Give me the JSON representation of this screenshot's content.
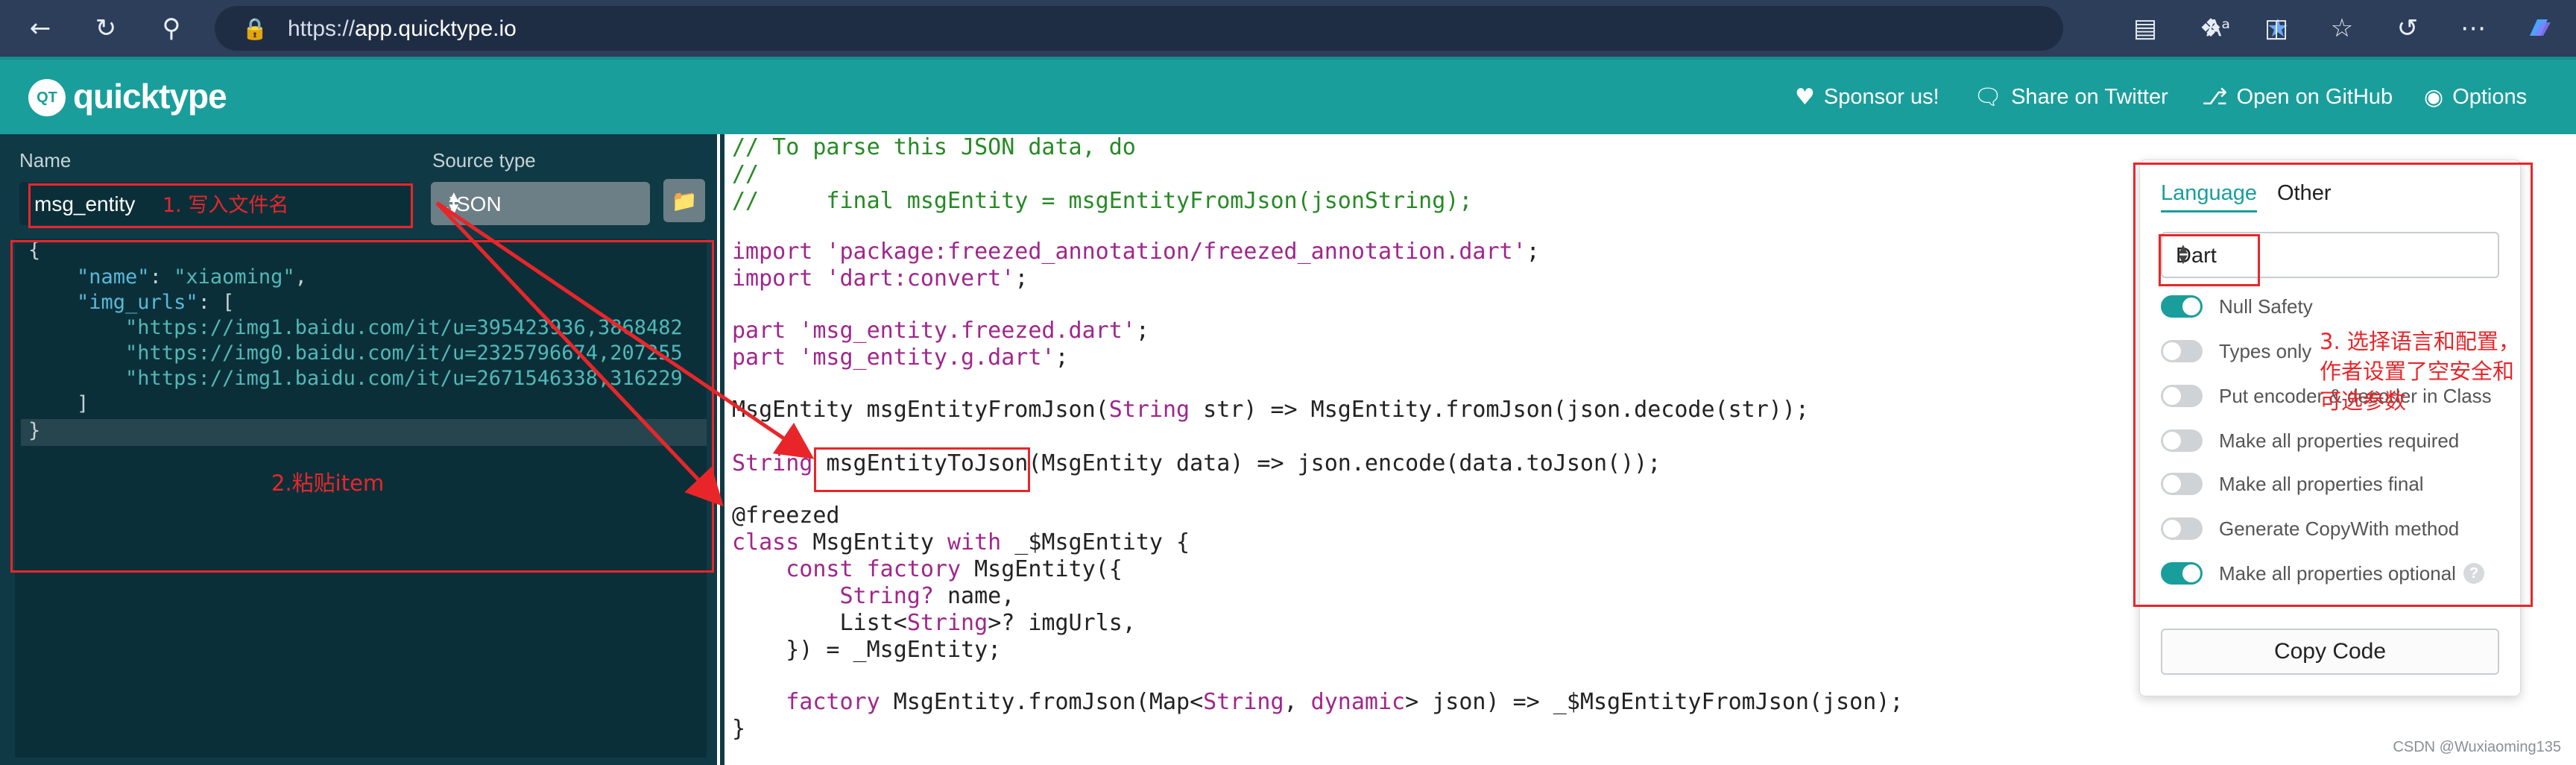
{
  "browser": {
    "url_scheme": "https://",
    "url_host": "app.quicktype.io",
    "icons": [
      "back-arrow-icon",
      "refresh-icon",
      "search-icon",
      "lock-icon",
      "read-aloud-icon",
      "favorite-star-icon",
      "reading-view-icon",
      "extensions-icon",
      "split-screen-icon",
      "favorites-icon",
      "history-icon",
      "more-icon",
      "copilot-icon"
    ]
  },
  "header": {
    "logo_badge": "QT",
    "brand": "quicktype",
    "links": {
      "sponsor": "Sponsor us!",
      "twitter": "Share on Twitter",
      "github": "Open on GitHub",
      "options": "Options"
    }
  },
  "left": {
    "name_label": "Name",
    "name_value": "msg_entity",
    "source_label": "Source type",
    "source_value": "JSON",
    "json_lines": {
      "l1": "{",
      "l2_key": "\"name\"",
      "l2_sep": ": ",
      "l2_val": "\"xiaoming\"",
      "l2_end": ",",
      "l3_key": "\"img_urls\"",
      "l3_rest": ": [",
      "l4": "\"https://img1.baidu.com/it/u=395423936,3868482",
      "l5": "\"https://img0.baidu.com/it/u=2325796674,207255",
      "l6": "\"https://img1.baidu.com/it/u=2671546338,316229",
      "l7": "]",
      "l8": "}"
    }
  },
  "annotations": {
    "a1": "1. 写入文件名",
    "a2": "2.粘贴item",
    "a3": "3. 选择语言和配置，\n作者设置了空安全和\n可选参数"
  },
  "code": {
    "c1": "// To parse this JSON data, do",
    "c2": "//",
    "c3": "//     final msgEntity = msgEntityFromJson(jsonString);",
    "c4_kw": "import",
    "c4_str": " 'package:freezed_annotation/freezed_annotation.dart'",
    "c4_end": ";",
    "c5_kw": "import",
    "c5_str": " 'dart:convert'",
    "c5_end": ";",
    "c6_kw": "part",
    "c6_str": " 'msg_entity.freezed.dart'",
    "c6_end": ";",
    "c7_kw": "part",
    "c7_str": " 'msg_entity.g.dart'",
    "c7_end": ";",
    "c8_a": "MsgEntity msgEntityFromJson(",
    "c8_ty": "String",
    "c8_b": " str) => MsgEntity.fromJson(json.decode(str));",
    "c9_ty": "String",
    "c9_fn": "msgEntityToJson",
    "c9_b": "(MsgEntity data) => json.encode(data.toJson());",
    "c10": "@freezed",
    "c11_kw": "class",
    "c11_b": " MsgEntity ",
    "c11_kw2": "with",
    "c11_c": " _$MsgEntity {",
    "c12_kw": "const factory",
    "c12_b": " MsgEntity({",
    "c13_ty": "String?",
    "c13_b": " name,",
    "c14_a": "List<",
    "c14_ty": "String",
    "c14_b": ">? imgUrls,",
    "c15": "}) = _MsgEntity;",
    "c16_kw": "factory",
    "c16_a": " MsgEntity.fromJson(Map<",
    "c16_ty": "String",
    "c16_b": ", ",
    "c16_ty2": "dynamic",
    "c16_c": "> json) => _$MsgEntityFromJson(json);",
    "c17": "}"
  },
  "options": {
    "tab_language": "Language",
    "tab_other": "Other",
    "language_value": "Dart",
    "items": [
      {
        "label": "Null Safety",
        "on": true
      },
      {
        "label": "Types only",
        "on": false
      },
      {
        "label": "Put encoder & decoder in Class",
        "on": false
      },
      {
        "label": "Make all properties required",
        "on": false
      },
      {
        "label": "Make all properties final",
        "on": false
      },
      {
        "label": "Generate CopyWith method",
        "on": false
      },
      {
        "label": "Make all properties optional",
        "on": true
      }
    ],
    "help_glyph": "?",
    "copy_button": "Copy Code"
  },
  "watermark": "CSDN @Wuxiaoming135",
  "colors": {
    "teal": "#1a9e9c",
    "annotation_red": "#e8262a",
    "editor_bg": "#0b2f39"
  }
}
